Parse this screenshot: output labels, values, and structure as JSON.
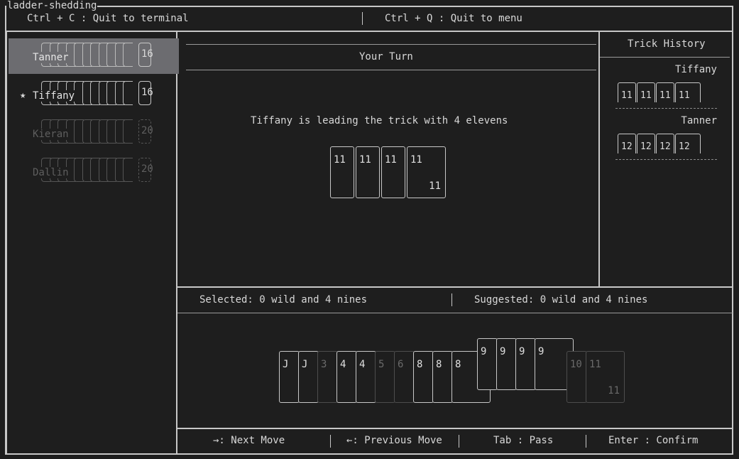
{
  "app": {
    "title": "ladder-shedding"
  },
  "header": {
    "quit_terminal": "Ctrl + C : Quit to terminal",
    "quit_menu": "Ctrl + Q : Quit to menu"
  },
  "players": [
    {
      "name": "Tanner",
      "count": "16",
      "active": true,
      "star": false
    },
    {
      "name": "Tiffany",
      "count": "16",
      "active": false,
      "star": true
    },
    {
      "name": "Kieran",
      "count": "20",
      "active": false,
      "star": false,
      "dim": true
    },
    {
      "name": "Dallin",
      "count": "20",
      "active": false,
      "star": false,
      "dim": true
    }
  ],
  "star_glyph": "★",
  "center": {
    "turn_label": "Your Turn",
    "status": "Tiffany is leading the trick with 4 elevens",
    "trick_cards": [
      "11",
      "11",
      "11",
      "11"
    ]
  },
  "history": {
    "title": "Trick History",
    "entries": [
      {
        "player": "Tiffany",
        "cards": [
          "11",
          "11",
          "11",
          "11"
        ]
      },
      {
        "player": "Tanner",
        "cards": [
          "12",
          "12",
          "12",
          "12"
        ]
      }
    ]
  },
  "selection": {
    "selected": "Selected: 0 wild and 4 nines",
    "suggested": "Suggested: 0 wild and 4 nines"
  },
  "hand": [
    {
      "rank": "J",
      "state": "normal"
    },
    {
      "rank": "J",
      "state": "normal"
    },
    {
      "rank": "3",
      "state": "dim"
    },
    {
      "rank": "4",
      "state": "normal"
    },
    {
      "rank": "4",
      "state": "normal"
    },
    {
      "rank": "5",
      "state": "dim"
    },
    {
      "rank": "6",
      "state": "dim"
    },
    {
      "rank": "8",
      "state": "normal"
    },
    {
      "rank": "8",
      "state": "normal"
    },
    {
      "rank": "8",
      "state": "normal"
    },
    {
      "rank": "9",
      "state": "raised"
    },
    {
      "rank": "9",
      "state": "raised"
    },
    {
      "rank": "9",
      "state": "raised"
    },
    {
      "rank": "9",
      "state": "raised"
    },
    {
      "rank": "10",
      "state": "dim"
    },
    {
      "rank": "11",
      "state": "dim"
    }
  ],
  "footer": {
    "next": "→: Next Move",
    "prev": "←: Previous Move",
    "pass": "Tab : Pass",
    "confirm": "Enter : Confirm"
  }
}
